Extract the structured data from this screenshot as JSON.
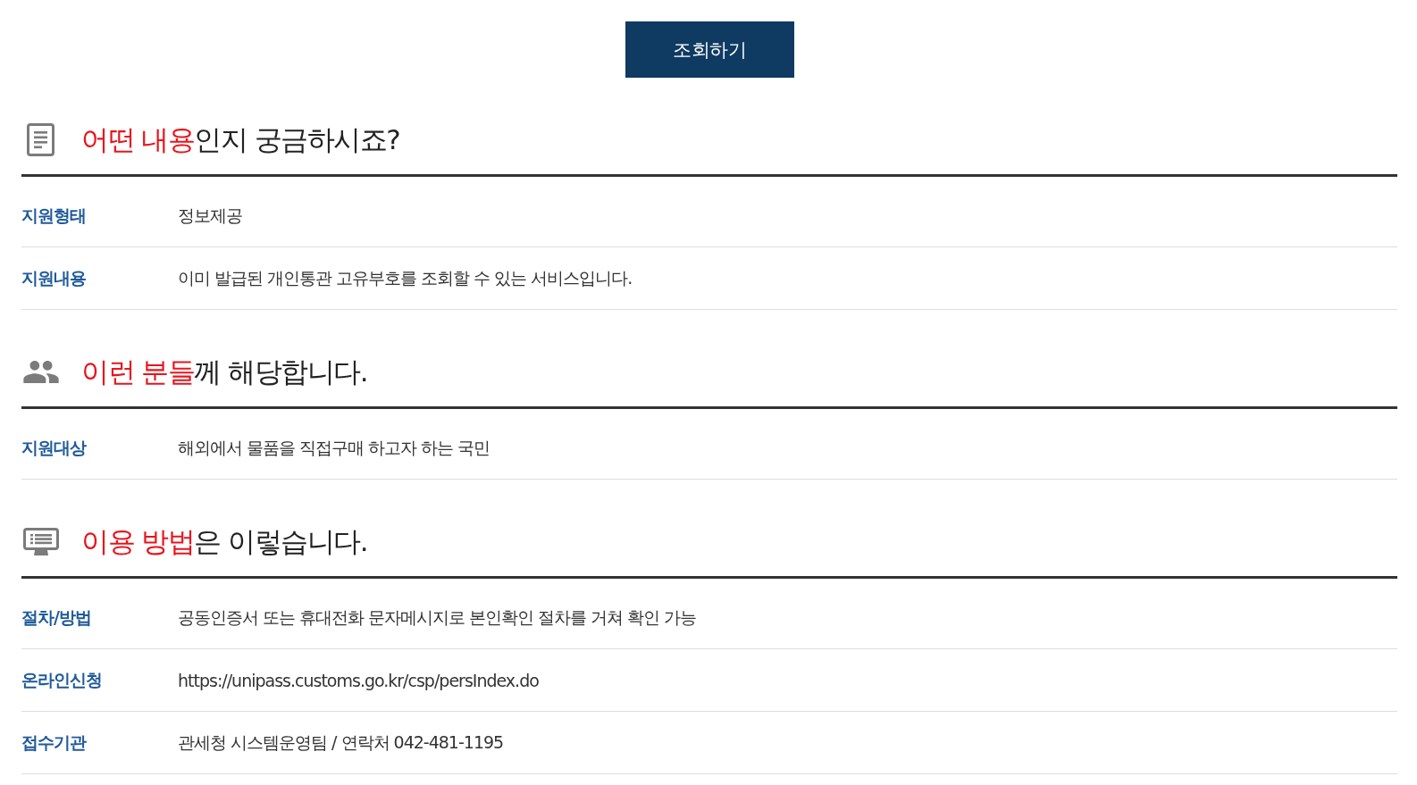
{
  "search_button": {
    "label": "조회하기"
  },
  "sections": [
    {
      "kind": "document",
      "title_highlight": "어떤 내용",
      "title_rest": "인지 궁금하시죠?",
      "rows": [
        {
          "label": "지원형태",
          "value": "정보제공"
        },
        {
          "label": "지원내용",
          "value": "이미 발급된 개인통관 고유부호를 조회할 수 있는 서비스입니다."
        }
      ]
    },
    {
      "kind": "people",
      "title_highlight": "이런 분들",
      "title_rest": "께 해당합니다.",
      "rows": [
        {
          "label": "지원대상",
          "value": "해외에서 물품을 직접구매 하고자 하는 국민"
        }
      ]
    },
    {
      "kind": "monitor",
      "title_highlight": "이용 방법",
      "title_rest": "은 이렇습니다.",
      "rows": [
        {
          "label": "절차/방법",
          "value": "공동인증서 또는 휴대전화 문자메시지로 본인확인 절차를 거쳐 확인 가능"
        },
        {
          "label": "온라인신청",
          "value": "https://unipass.customs.go.kr/csp/persIndex.do"
        },
        {
          "label": "접수기관",
          "value": "관세청 시스템운영팀 / 연락처 042-481-1195"
        }
      ]
    }
  ]
}
